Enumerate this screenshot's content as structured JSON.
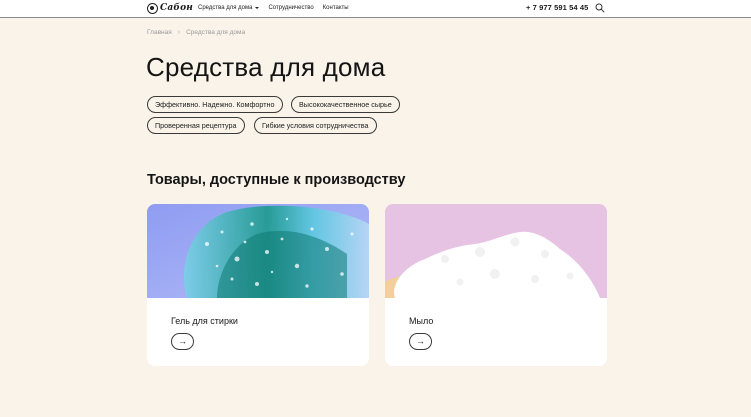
{
  "header": {
    "logo_text": "Сабон",
    "nav": [
      {
        "label": "Средства для дома",
        "has_dropdown": true
      },
      {
        "label": "Сотрудничество",
        "has_dropdown": false
      },
      {
        "label": "Контакты",
        "has_dropdown": false
      }
    ],
    "phone": "+ 7 977 591 54 45",
    "search_icon": "search-icon"
  },
  "breadcrumb": {
    "home": "Главная",
    "separator": "›",
    "current": "Средства для дома"
  },
  "page_title": "Средства для дома",
  "tags": [
    "Эффективно. Надежно. Комфортно",
    "Высококачественное сырье",
    "Проверенная рецептура",
    "Гибкие условия сотрудничества"
  ],
  "section_title": "Товары, доступные к производству",
  "products": [
    {
      "title": "Гель для стирки",
      "arrow": "→"
    },
    {
      "title": "Мыло",
      "arrow": "→"
    }
  ],
  "colors": {
    "background": "#f9f3ea",
    "card": "#ffffff",
    "gel_bg": "#9aa8f0",
    "soap_bg": "#e8c4e4"
  }
}
